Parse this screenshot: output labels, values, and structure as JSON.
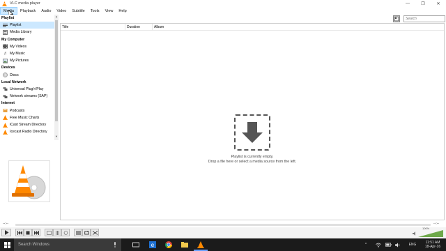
{
  "window": {
    "title": "VLC media player",
    "controls": [
      "—",
      "❐",
      "✕"
    ]
  },
  "menu": [
    "Media",
    "Playback",
    "Audio",
    "Video",
    "Subtitle",
    "Tools",
    "View",
    "Help"
  ],
  "sidebar": {
    "categories": [
      {
        "label": "Playlist",
        "items": [
          {
            "label": "Playlist",
            "icon": "playlist-icon",
            "selected": true
          },
          {
            "label": "Media Library",
            "icon": "media-library-icon"
          }
        ]
      },
      {
        "label": "My Computer",
        "items": [
          {
            "label": "My Videos",
            "icon": "videos-icon"
          },
          {
            "label": "My Music",
            "icon": "music-icon"
          },
          {
            "label": "My Pictures",
            "icon": "pictures-icon"
          }
        ]
      },
      {
        "label": "Devices",
        "items": [
          {
            "label": "Discs",
            "icon": "disc-icon"
          }
        ]
      },
      {
        "label": "Local Network",
        "items": [
          {
            "label": "Universal Plug'n'Play",
            "icon": "upnp-icon"
          },
          {
            "label": "Network streams (SAP)",
            "icon": "network-icon"
          }
        ]
      },
      {
        "label": "Internet",
        "items": [
          {
            "label": "Podcasts",
            "icon": "podcast-icon"
          },
          {
            "label": "Free Music Charts",
            "icon": "charts-icon"
          },
          {
            "label": "iCast Stream Directory",
            "icon": "icast-icon"
          },
          {
            "label": "Icecast Radio Directory",
            "icon": "icecast-icon"
          }
        ]
      }
    ]
  },
  "search": {
    "placeholder": "Search"
  },
  "playlist": {
    "columns": [
      "Title",
      "Duration",
      "Album"
    ],
    "empty_line1": "Playlist is currently empty.",
    "empty_line2": "Drop a file here or select a media source from the left."
  },
  "seek": {
    "elapsed": "--:--",
    "remaining": "--:--"
  },
  "volume": {
    "label": "100%",
    "level": 1.0
  },
  "taskbar": {
    "search_placeholder": "Search Windows",
    "language": "ENG",
    "time": "11:51 AM",
    "date": "18-Apr-16"
  },
  "colors": {
    "accent": "#ff8800",
    "selection": "#cce8ff",
    "taskbar": "#1b1b1b"
  }
}
